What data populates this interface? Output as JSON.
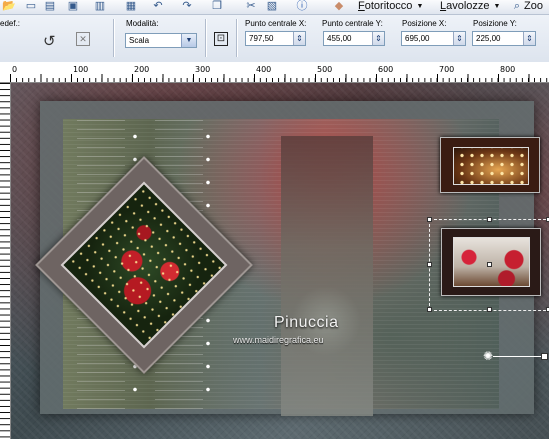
{
  "toolbar": {
    "menus": [
      {
        "label": "Fotoritocco",
        "underline": "F",
        "rest": "otoritocco"
      },
      {
        "label": "Lavolozze",
        "underline": "L",
        "rest": "avolozze"
      },
      {
        "label": "Zoo"
      }
    ]
  },
  "options": {
    "preset_label": "edef.:",
    "mode_label": "Modalità:",
    "mode_value": "Scala",
    "center_x_label": "Punto centrale X:",
    "center_x_value": "797,50",
    "center_y_label": "Punto centrale Y:",
    "center_y_value": "455,00",
    "pos_x_label": "Posizione X:",
    "pos_x_value": "695,00",
    "pos_y_label": "Posizione Y:",
    "pos_y_value": "225,00"
  },
  "ruler": {
    "labels": [
      "0",
      "100",
      "200",
      "300",
      "400",
      "500",
      "600",
      "700",
      "800"
    ]
  },
  "canvas": {
    "watermark_name": "Pinuccia",
    "watermark_url": "www.maidiregrafica.eu"
  }
}
